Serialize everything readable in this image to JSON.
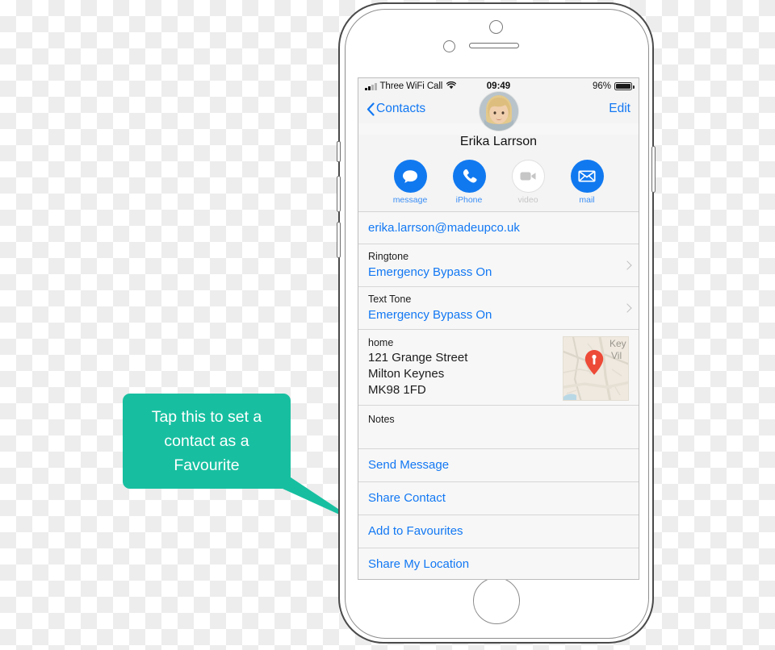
{
  "status_bar": {
    "signal_icon": "signal-bars-icon",
    "carrier": "Three WiFi Call",
    "wifi_icon": "wifi-icon",
    "time": "09:49",
    "battery_percent": "96%",
    "battery_icon": "battery-icon"
  },
  "nav": {
    "back_icon": "chevron-left-icon",
    "back_label": "Contacts",
    "edit_label": "Edit"
  },
  "contact": {
    "avatar_name": "avatar",
    "name": "Erika Larrson",
    "actions": [
      {
        "label": "message",
        "icon": "message-bubble-icon",
        "disabled": false
      },
      {
        "label": "iPhone",
        "icon": "phone-handset-icon",
        "disabled": false
      },
      {
        "label": "video",
        "icon": "video-camera-icon",
        "disabled": true
      },
      {
        "label": "mail",
        "icon": "envelope-icon",
        "disabled": false
      }
    ],
    "email": "erika.larrson@madeupco.uk",
    "ringtone": {
      "label": "Ringtone",
      "value": "Emergency Bypass On"
    },
    "text_tone": {
      "label": "Text Tone",
      "value": "Emergency Bypass On"
    },
    "address": {
      "label": "home",
      "line1": "121 Grange Street",
      "line2": "Milton Keynes",
      "line3": "MK98 1FD",
      "map_icon": "map-pin-icon",
      "map_label_1": "Key",
      "map_label_2": "Vil"
    },
    "notes": {
      "label": "Notes",
      "value": ""
    },
    "links": [
      "Send Message",
      "Share Contact",
      "Add to Favourites",
      "Share My Location"
    ]
  },
  "callout": {
    "text": "Tap this to set a contact as a Favourite",
    "color": "#17bfa0"
  },
  "device": {
    "camera_icon": "camera-icon",
    "sensor_icon": "proximity-sensor-icon",
    "speaker_icon": "earpiece-speaker-icon",
    "home_button_icon": "home-button-icon",
    "silent_switch_icon": "silent-switch-icon",
    "volume_up_icon": "volume-up-button-icon",
    "volume_down_icon": "volume-down-button-icon",
    "power_icon": "power-button-icon"
  },
  "colors": {
    "ios_blue": "#1278f3",
    "callout_teal": "#17bfa0",
    "pin_red": "#ed4a38"
  }
}
